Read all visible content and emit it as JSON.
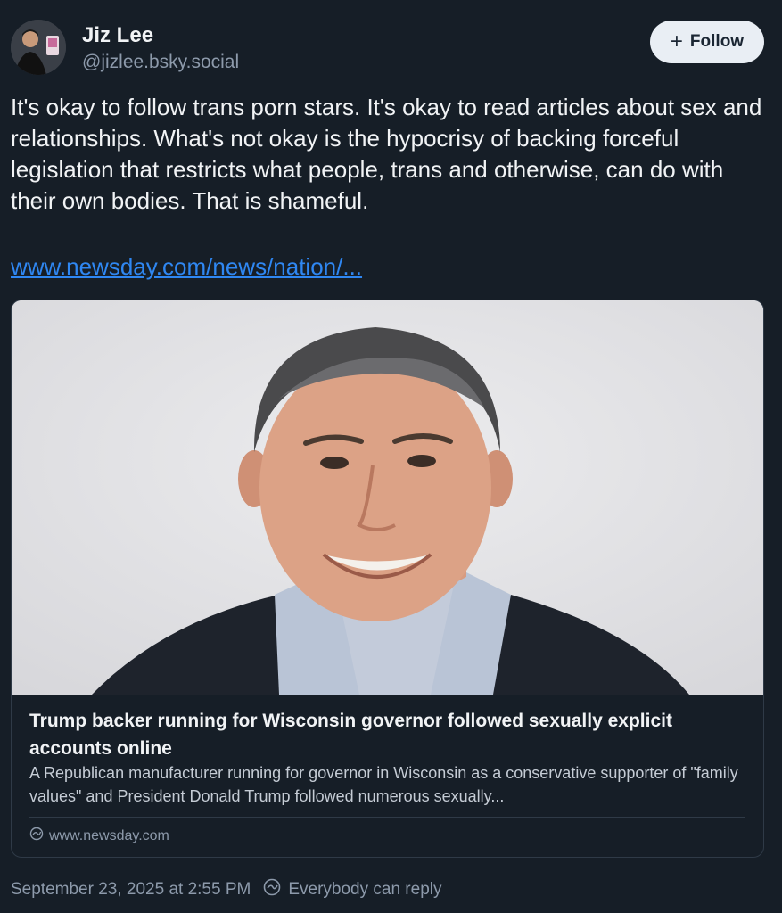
{
  "author": {
    "name": "Jiz Lee",
    "handle": "@jizlee.bsky.social"
  },
  "follow_button": {
    "icon": "plus-icon",
    "label": "Follow"
  },
  "post": {
    "text": "It's okay to follow trans porn stars. It's okay to read articles about sex and relationships. What's not okay is the hypocrisy of backing forceful legislation that restricts what people, trans and otherwise, can do with their own bodies. That is shameful.",
    "link_text": "www.newsday.com/news/nation/..."
  },
  "link_card": {
    "title": "Trump backer running for Wisconsin governor followed sexually explicit accounts online",
    "description": "A Republican manufacturer running for governor in Wisconsin as a conservative supporter of \"family values\" and President Donald Trump followed numerous sexually...",
    "domain": "www.newsday.com",
    "domain_icon": "globe-icon"
  },
  "footer": {
    "timestamp": "September 23, 2025 at 2:55 PM",
    "reply_setting": "Everybody can reply",
    "reply_icon": "globe-icon"
  },
  "colors": {
    "background": "#161e27",
    "link": "#2f87f2",
    "muted": "#8d9aab",
    "button_bg": "#e9eef4"
  }
}
